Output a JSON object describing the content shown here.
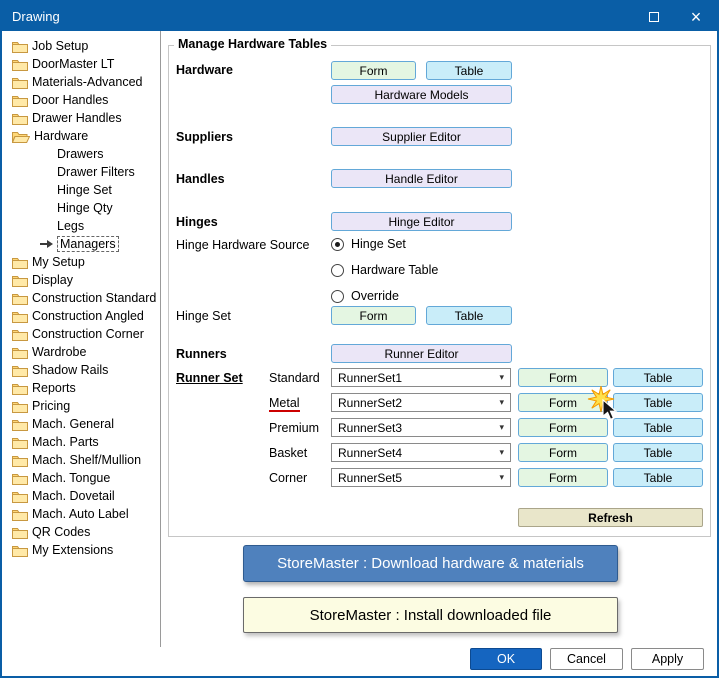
{
  "window": {
    "title": "Drawing"
  },
  "titlebar": {
    "close_glyph": "×",
    "icons": [
      "maximize-icon",
      "close-icon"
    ]
  },
  "sidebar": {
    "items": [
      {
        "label": "Job Setup",
        "icon": "folder",
        "level": 0
      },
      {
        "label": "DoorMaster LT",
        "icon": "folder",
        "level": 0
      },
      {
        "label": "Materials-Advanced",
        "icon": "folder",
        "level": 0
      },
      {
        "label": "Door Handles",
        "icon": "folder",
        "level": 0
      },
      {
        "label": "Drawer Handles",
        "icon": "folder",
        "level": 0
      },
      {
        "label": "Hardware",
        "icon": "folder-open",
        "level": 0
      },
      {
        "label": "Drawers",
        "icon": "none",
        "level": 1
      },
      {
        "label": "Drawer Filters",
        "icon": "none",
        "level": 1
      },
      {
        "label": "Hinge Set",
        "icon": "none",
        "level": 1
      },
      {
        "label": "Hinge Qty",
        "icon": "none",
        "level": 1
      },
      {
        "label": "Legs",
        "icon": "none",
        "level": 1
      },
      {
        "label": "Managers",
        "icon": "arrow",
        "level": 1,
        "selected": true
      },
      {
        "label": "My Setup",
        "icon": "folder",
        "level": 0
      },
      {
        "label": "Display",
        "icon": "folder",
        "level": 0
      },
      {
        "label": "Construction Standard",
        "icon": "folder",
        "level": 0
      },
      {
        "label": "Construction Angled",
        "icon": "folder",
        "level": 0
      },
      {
        "label": "Construction Corner",
        "icon": "folder",
        "level": 0
      },
      {
        "label": "Wardrobe",
        "icon": "folder",
        "level": 0
      },
      {
        "label": "Shadow Rails",
        "icon": "folder",
        "level": 0
      },
      {
        "label": "Reports",
        "icon": "folder",
        "level": 0
      },
      {
        "label": "Pricing",
        "icon": "folder",
        "level": 0
      },
      {
        "label": "Mach. General",
        "icon": "folder",
        "level": 0
      },
      {
        "label": "Mach. Parts",
        "icon": "folder",
        "level": 0
      },
      {
        "label": "Mach. Shelf/Mullion",
        "icon": "folder",
        "level": 0
      },
      {
        "label": "Mach. Tongue",
        "icon": "folder",
        "level": 0
      },
      {
        "label": "Mach. Dovetail",
        "icon": "folder",
        "level": 0
      },
      {
        "label": "Mach. Auto Label",
        "icon": "folder",
        "level": 0
      },
      {
        "label": "QR Codes",
        "icon": "folder",
        "level": 0
      },
      {
        "label": "My Extensions",
        "icon": "folder",
        "level": 0
      }
    ]
  },
  "main": {
    "group_title": "Manage Hardware Tables",
    "hardware": {
      "label": "Hardware",
      "form": "Form",
      "table": "Table",
      "models": "Hardware Models"
    },
    "suppliers": {
      "label": "Suppliers",
      "editor": "Supplier Editor"
    },
    "handles": {
      "label": "Handles",
      "editor": "Handle Editor"
    },
    "hinges": {
      "label": "Hinges",
      "editor": "Hinge Editor"
    },
    "hinge_source": {
      "label": "Hinge Hardware Source",
      "options": [
        {
          "label": "Hinge Set",
          "selected": true
        },
        {
          "label": "Hardware Table",
          "selected": false
        },
        {
          "label": "Override",
          "selected": false
        }
      ]
    },
    "hinge_set": {
      "label": "Hinge Set",
      "form": "Form",
      "table": "Table"
    },
    "runners": {
      "label": "Runners",
      "editor": "Runner Editor"
    },
    "runner_set": {
      "label": "Runner Set",
      "rows": [
        {
          "name": "Standard",
          "value": "RunnerSet1",
          "form": "Form",
          "table": "Table",
          "underline": false
        },
        {
          "name": "Metal",
          "value": "RunnerSet2",
          "form": "Form",
          "table": "Table",
          "underline": true
        },
        {
          "name": "Premium",
          "value": "RunnerSet3",
          "form": "Form",
          "table": "Table",
          "underline": false
        },
        {
          "name": "Basket",
          "value": "RunnerSet4",
          "form": "Form",
          "table": "Table",
          "underline": false
        },
        {
          "name": "Corner",
          "value": "RunnerSet5",
          "form": "Form",
          "table": "Table",
          "underline": false
        }
      ]
    },
    "refresh_label": "Refresh"
  },
  "storemaster": {
    "download_label": "StoreMaster : Download hardware & materials",
    "install_label": "StoreMaster : Install downloaded file"
  },
  "footer": {
    "ok": "OK",
    "cancel": "Cancel",
    "apply": "Apply"
  },
  "colors": {
    "titlebar": "#0a5ea6",
    "form_button": "#e4f6e2",
    "table_button": "#c9edf9",
    "editor_button": "#ebe6f7",
    "refresh_button": "#e9e6ca",
    "download_button": "#4f81bd",
    "install_button": "#fcfce2",
    "ok_button": "#1565c0",
    "metal_underline": "#cc0000"
  }
}
